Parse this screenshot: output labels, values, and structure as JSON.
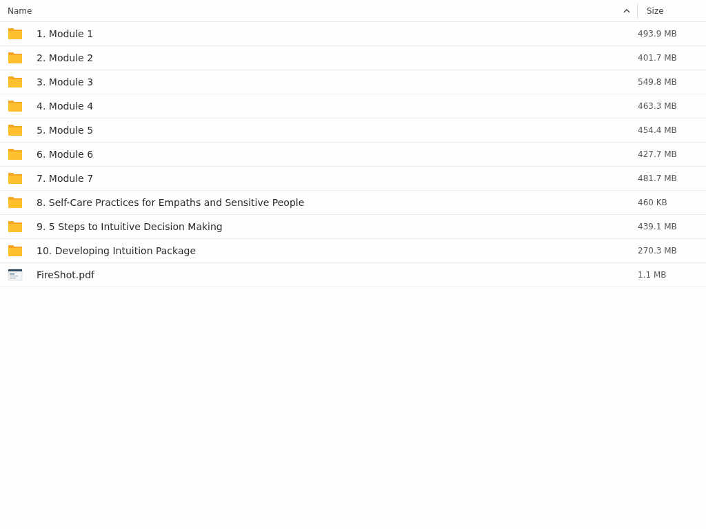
{
  "table": {
    "columns": [
      {
        "label": "Name",
        "sorted": true,
        "ascending": true
      },
      {
        "label": "Size",
        "sorted": false
      }
    ],
    "rows": [
      {
        "kind": "folder",
        "name": "1. Module 1",
        "size": "493.9 MB"
      },
      {
        "kind": "folder",
        "name": "2. Module 2",
        "size": "401.7 MB"
      },
      {
        "kind": "folder",
        "name": "3. Module 3",
        "size": "549.8 MB"
      },
      {
        "kind": "folder",
        "name": "4. Module 4",
        "size": "463.3 MB"
      },
      {
        "kind": "folder",
        "name": "5. Module 5",
        "size": "454.4 MB"
      },
      {
        "kind": "folder",
        "name": "6. Module 6",
        "size": "427.7 MB"
      },
      {
        "kind": "folder",
        "name": "7. Module 7",
        "size": "481.7 MB"
      },
      {
        "kind": "folder",
        "name": "8. Self-Care Practices for Empaths and Sensitive People",
        "size": "460 KB"
      },
      {
        "kind": "folder",
        "name": "9. 5 Steps to Intuitive Decision Making",
        "size": "439.1 MB"
      },
      {
        "kind": "folder",
        "name": "10. Developing Intuition Package",
        "size": "270.3 MB"
      },
      {
        "kind": "pdf",
        "name": "FireShot.pdf",
        "size": "1.1 MB"
      }
    ]
  }
}
